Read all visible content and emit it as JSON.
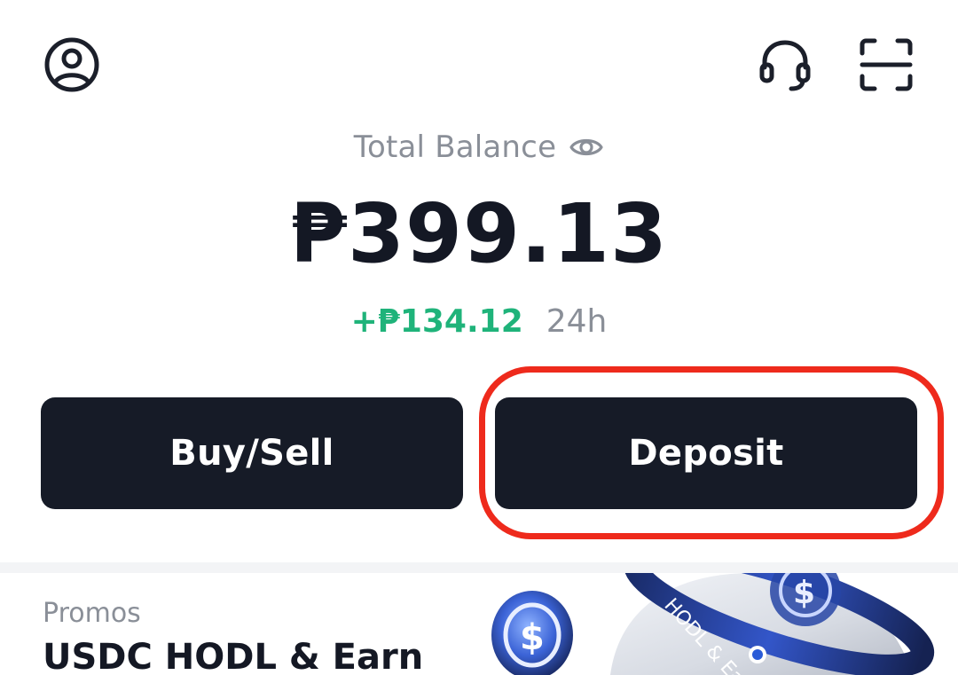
{
  "header": {
    "profile_icon": "user-circle-icon",
    "support_icon": "headset-icon",
    "scan_icon": "scan-frame-icon"
  },
  "balance": {
    "label": "Total Balance",
    "visibility_icon": "eye-icon",
    "amount": "₱399.13",
    "change_value": "+₱134.12",
    "change_period": "24h"
  },
  "actions": {
    "buy_sell_label": "Buy/Sell",
    "deposit_label": "Deposit"
  },
  "promo": {
    "tag": "Promos",
    "title": "USDC HODL & Earn",
    "art_text": "HODL & Earn"
  },
  "colors": {
    "primary_button": "#161b27",
    "positive": "#1fb37a",
    "muted_text": "#8a8f98",
    "highlight": "#ee2a1c"
  }
}
